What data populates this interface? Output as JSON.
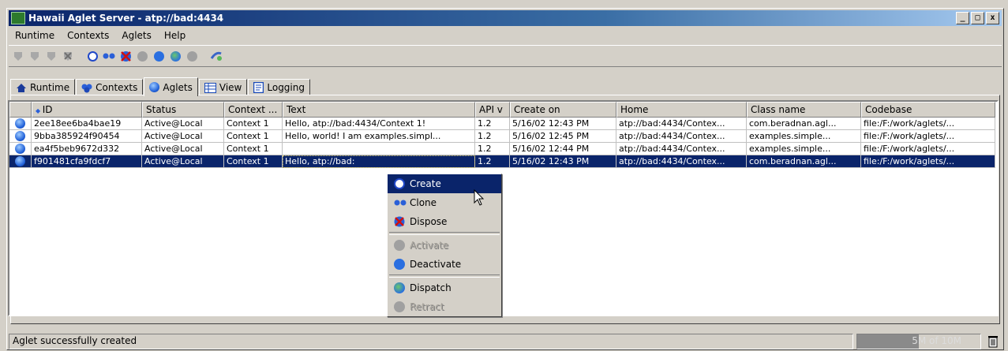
{
  "window": {
    "title": "Hawaii Aglet Server - atp://bad:4434",
    "controls": [
      "_",
      "□",
      "x"
    ]
  },
  "menubar": {
    "items": [
      "Runtime",
      "Contexts",
      "Aglets",
      "Help"
    ]
  },
  "toolbar": {
    "icons": [
      "context-gray-icon",
      "context-gray-icon",
      "context-gray-icon",
      "context-remove-icon",
      "create-icon",
      "clone-icon",
      "dispose-icon",
      "activate-icon",
      "deactivate-icon",
      "dispatch-icon",
      "retract-icon",
      "refresh-icon"
    ]
  },
  "tabs": [
    {
      "label": "Runtime",
      "icon": "home-icon"
    },
    {
      "label": "Contexts",
      "icon": "contexts-icon"
    },
    {
      "label": "Aglets",
      "icon": "aglets-icon",
      "active": true
    },
    {
      "label": "View",
      "icon": "view-icon"
    },
    {
      "label": "Logging",
      "icon": "logging-icon"
    }
  ],
  "table": {
    "columns": [
      "",
      "ID",
      "Status",
      "Context ...",
      "Text",
      "API v",
      "Create on",
      "Home",
      "Class name",
      "Codebase"
    ],
    "rows": [
      [
        "",
        "2ee18ee6ba4bae19",
        "Active@Local",
        "Context 1",
        "Hello, atp://bad:4434/Context 1!",
        "1.2",
        "5/16/02 12:43 PM",
        "atp://bad:4434/Contex...",
        "com.beradnan.agl...",
        "file:/F:/work/aglets/..."
      ],
      [
        "",
        "9bba385924f90454",
        "Active@Local",
        "Context 1",
        "Hello, world! I am examples.simpl...",
        "1.2",
        "5/16/02 12:45 PM",
        "atp://bad:4434/Contex...",
        "examples.simple...",
        "file:/F:/work/aglets/..."
      ],
      [
        "",
        "ea4f5beb9672d332",
        "Active@Local",
        "Context 1",
        "",
        "1.2",
        "5/16/02 12:44 PM",
        "atp://bad:4434/Contex...",
        "examples.simple...",
        "file:/F:/work/aglets/..."
      ],
      [
        "",
        "f901481cfa9fdcf7",
        "Active@Local",
        "Context 1",
        "Hello, atp://bad:",
        "1.2",
        "5/16/02 12:43 PM",
        "atp://bad:4434/Contex...",
        "com.beradnan.agl...",
        "file:/F:/work/aglets/..."
      ]
    ],
    "selected_row": 3
  },
  "context_menu": {
    "items": [
      {
        "label": "Create",
        "icon": "create-icon",
        "highlighted": true,
        "enabled": true
      },
      {
        "label": "Clone",
        "icon": "clone-icon",
        "enabled": true
      },
      {
        "label": "Dispose",
        "icon": "dispose-icon",
        "enabled": true
      },
      {
        "label": "Activate",
        "icon": "activate-icon",
        "enabled": false
      },
      {
        "label": "Deactivate",
        "icon": "deactivate-icon",
        "enabled": true
      },
      {
        "label": "Dispatch",
        "icon": "dispatch-icon",
        "enabled": true
      },
      {
        "label": "Retract",
        "icon": "retract-icon",
        "enabled": false
      }
    ]
  },
  "statusbar": {
    "message": "Aglet successfully created",
    "memory": "5M of 10M",
    "memory_used_fraction": 0.5
  },
  "colors": {
    "selection": "#0a246a",
    "face": "#d4d0c8",
    "agent_blue": "#1e5fd8"
  }
}
